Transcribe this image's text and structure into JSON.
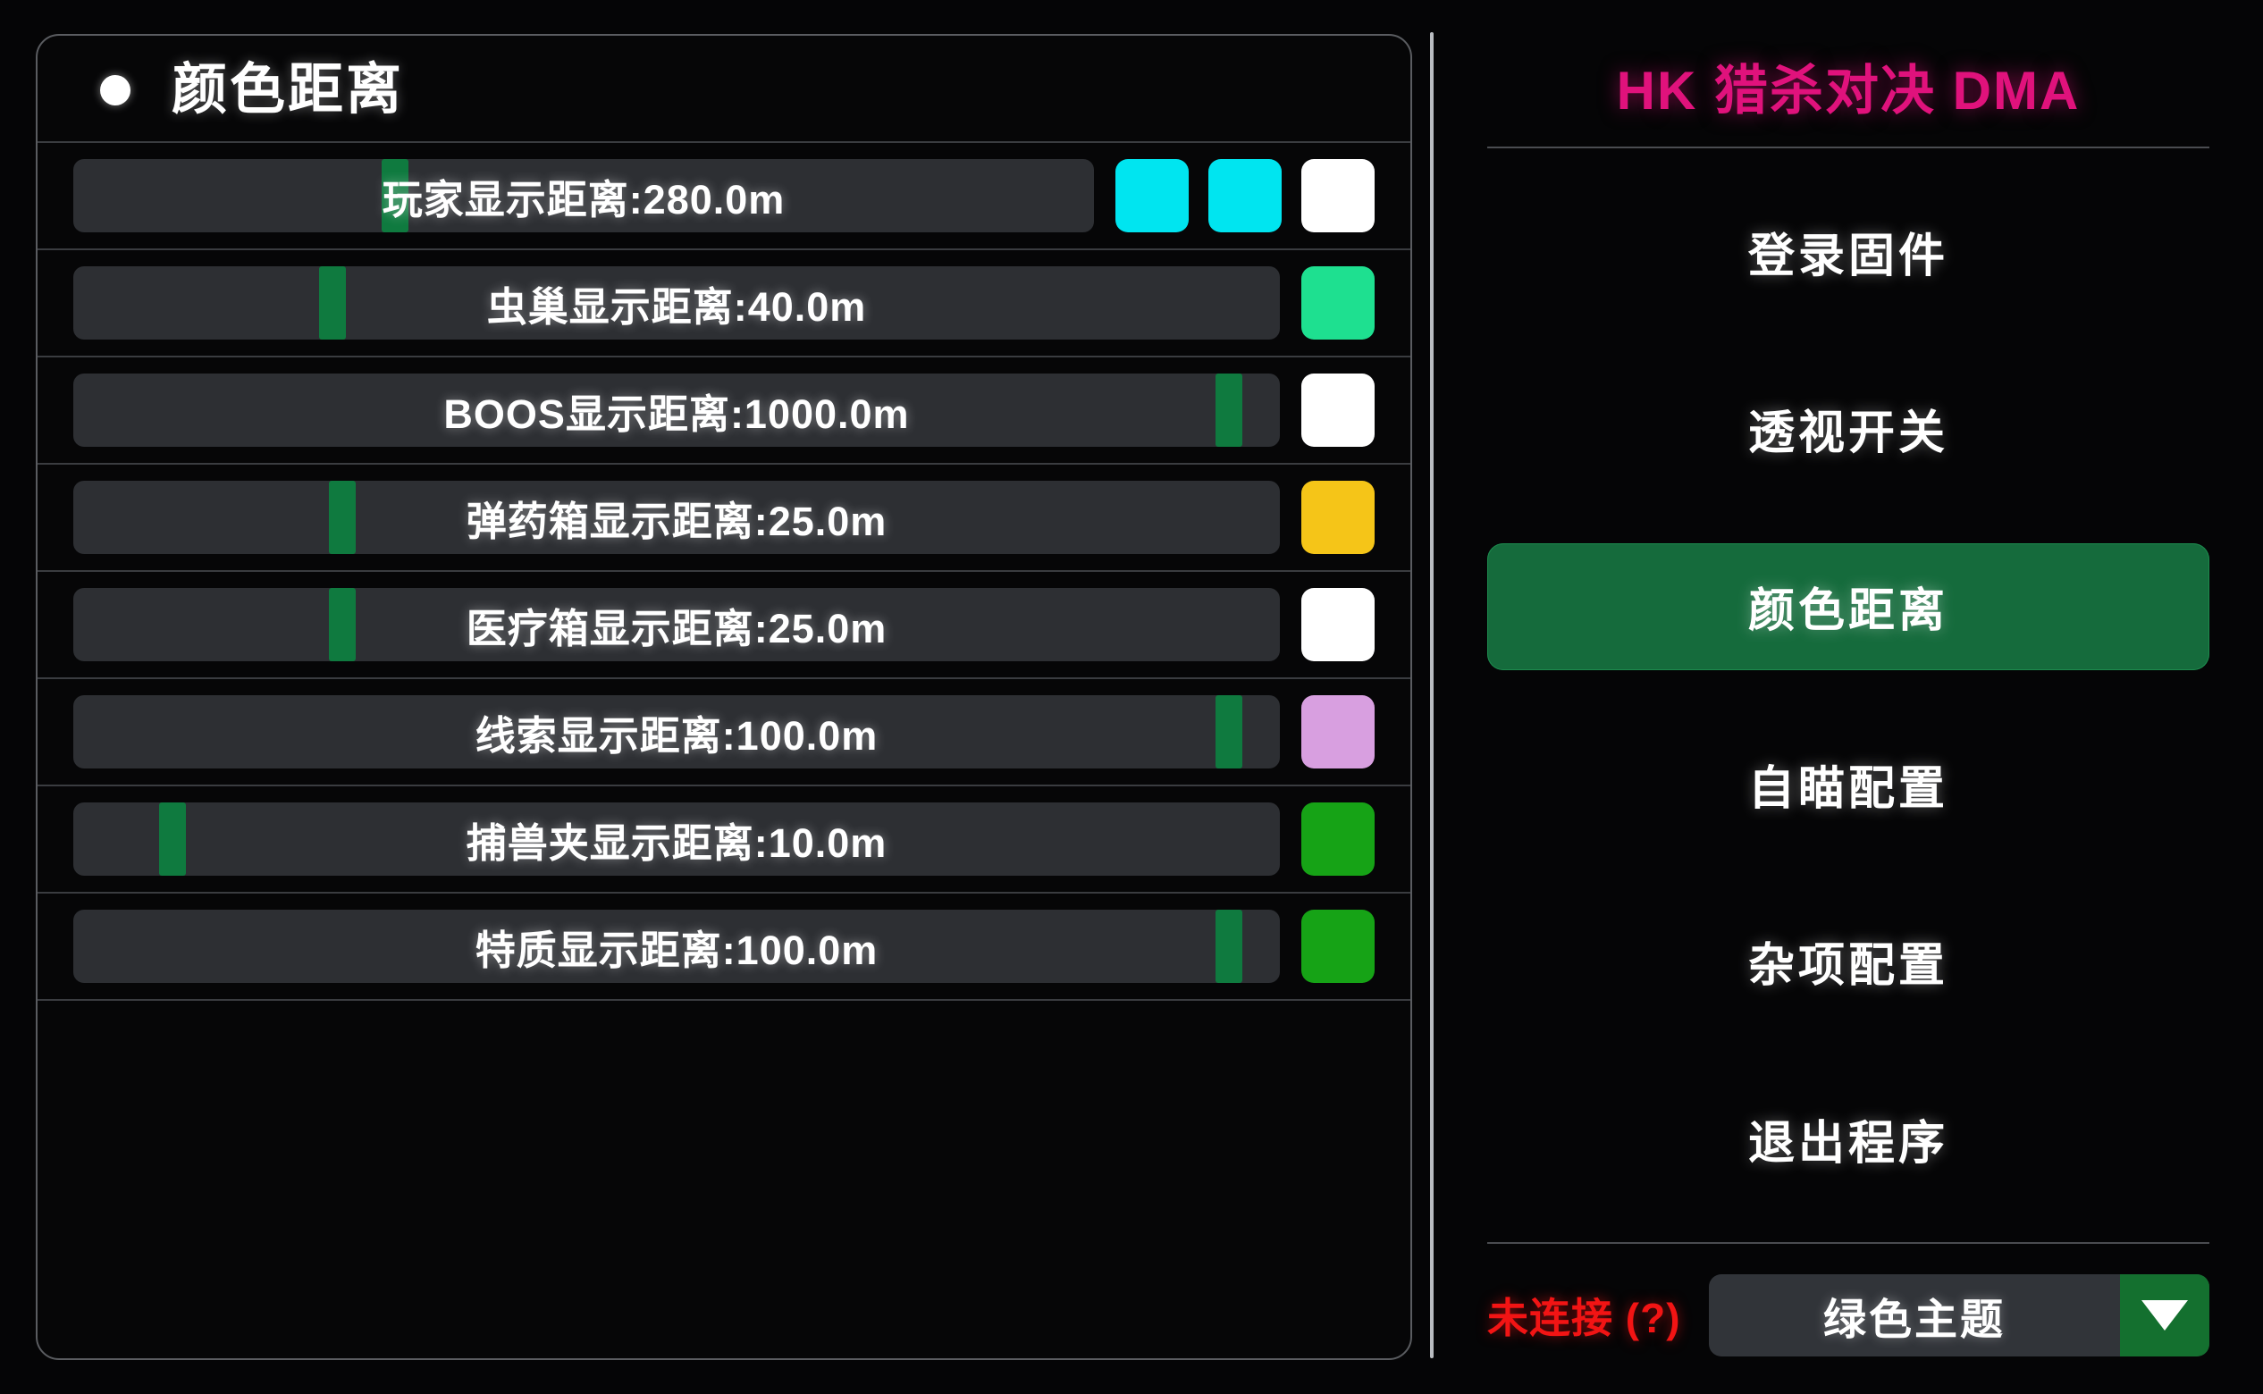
{
  "left_panel": {
    "bullet_icon": "dot-icon",
    "title": "颜色距离",
    "rows": [
      {
        "label": "玩家显示距离:280.0m",
        "handle_pct": 31.5,
        "swatches": [
          "#00E5F0",
          "#00E5F0",
          "#FFFFFF"
        ]
      },
      {
        "label": "虫巢显示距离:40.0m",
        "handle_pct": 21.5,
        "swatches": [
          "#1EE090"
        ]
      },
      {
        "label": "BOOS显示距离:1000.0m",
        "handle_pct": 95.8,
        "swatches": [
          "#FFFFFF"
        ]
      },
      {
        "label": "弹药箱显示距离:25.0m",
        "handle_pct": 22.3,
        "swatches": [
          "#F5C518"
        ]
      },
      {
        "label": "医疗箱显示距离:25.0m",
        "handle_pct": 22.3,
        "swatches": [
          "#FFFFFF"
        ]
      },
      {
        "label": "线索显示距离:100.0m",
        "handle_pct": 95.8,
        "swatches": [
          "#D89FE0"
        ]
      },
      {
        "label": "捕兽夹显示距离:10.0m",
        "handle_pct": 8.2,
        "swatches": [
          "#16A316"
        ]
      },
      {
        "label": "特质显示距离:100.0m",
        "handle_pct": 95.8,
        "swatches": [
          "#16A316"
        ]
      }
    ]
  },
  "sidebar": {
    "brand": "HK 猎杀对决 DMA",
    "items": [
      {
        "label": "登录固件",
        "active": false
      },
      {
        "label": "透视开关",
        "active": false
      },
      {
        "label": "颜色距离",
        "active": true
      },
      {
        "label": "自瞄配置",
        "active": false
      },
      {
        "label": "杂项配置",
        "active": false
      },
      {
        "label": "退出程序",
        "active": false
      }
    ],
    "footer": {
      "status": "未连接 (?)",
      "theme_value": "绿色主题",
      "arrow_icon": "chevron-down-icon"
    }
  },
  "colors": {
    "brand": "#E0127C",
    "active": "#156B3C",
    "status": "#F21414",
    "slider_handle": "#0F7A3F"
  }
}
